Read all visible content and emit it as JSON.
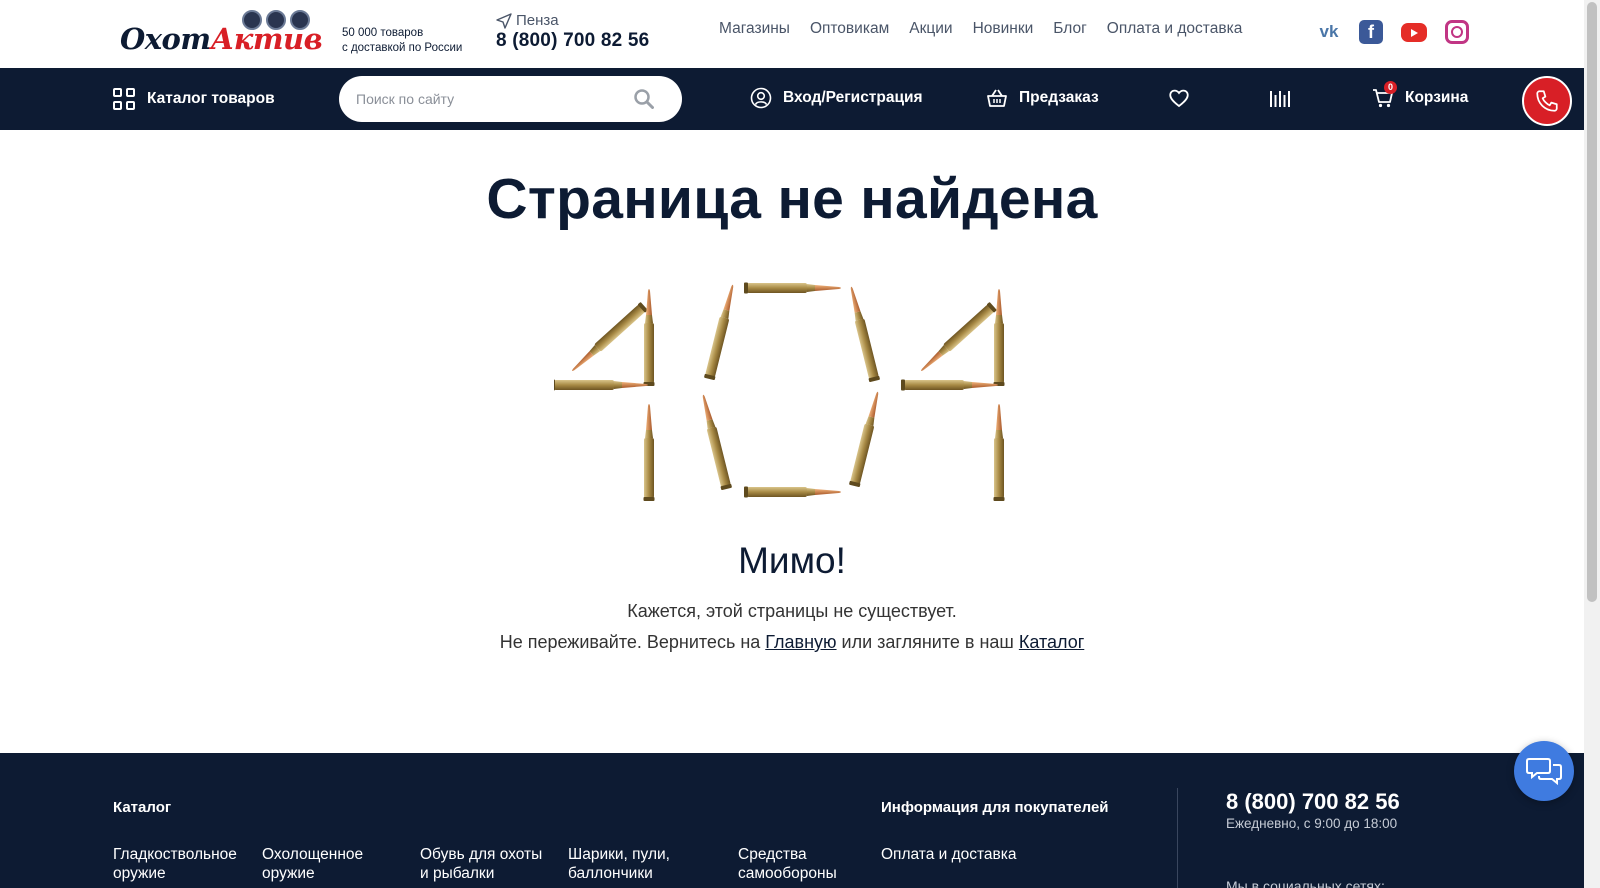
{
  "header": {
    "logo_part1": "Охот",
    "logo_part2": "Актив",
    "tagline_line1": "50 000 товаров",
    "tagline_line2": "с доставкой по России",
    "city": "Пенза",
    "phone": "8 (800) 700 82 56",
    "nav": [
      "Магазины",
      "Оптовикам",
      "Акции",
      "Новинки",
      "Блог",
      "Оплата и доставка"
    ],
    "socials": [
      "vk-icon",
      "facebook-icon",
      "youtube-icon",
      "instagram-icon"
    ]
  },
  "navbar": {
    "catalog_label": "Каталог товаров",
    "search_placeholder": "Поиск по сайту",
    "login_label": "Вход/Регистрация",
    "preorder_label": "Предзаказ",
    "cart_label": "Корзина",
    "cart_count": "0"
  },
  "main": {
    "title": "Страница не найдена",
    "subtitle": "Мимо!",
    "message_line1": "Кажется, этой страницы не существует.",
    "message_prefix": "Не переживайте. Вернитесь на ",
    "home_link": "Главную",
    "message_middle": " или загляните в наш ",
    "catalog_link": "Каталог"
  },
  "footer": {
    "catalog_heading": "Каталог",
    "catalog_items": [
      [
        "Гладкоствольное",
        "оружие"
      ],
      [
        "Охолощенное",
        "оружие"
      ],
      [
        "Обувь для охоты",
        "и рыбалки"
      ],
      [
        "Шарики, пули,",
        "баллончики"
      ],
      [
        "Средства",
        "самообороны"
      ]
    ],
    "info_heading": "Информация для покупателей",
    "info_items": [
      "Оплата и доставка"
    ],
    "phone": "8 (800) 700 82 56",
    "hours": "Ежедневно, с 9:00 до 18:00",
    "social_text": "Мы в социальных сетях:"
  },
  "colors": {
    "navy": "#0d1b33",
    "accent_red": "#d81f26",
    "chat_blue": "#3f7be0"
  }
}
